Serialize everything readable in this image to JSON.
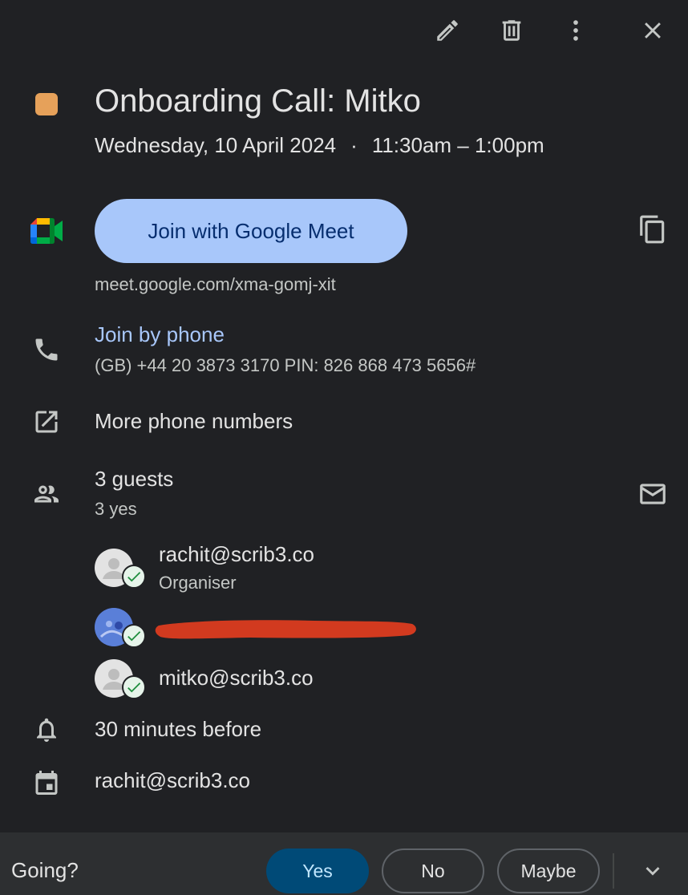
{
  "toolbar": {
    "icons": [
      "edit-icon",
      "delete-icon",
      "more-vert-icon",
      "close-icon"
    ]
  },
  "event": {
    "title": "Onboarding Call: Mitko",
    "date": "Wednesday, 10 April 2024",
    "separator": "·",
    "time": "11:30am – 1:00pm",
    "color": "#e6a15a"
  },
  "meet": {
    "button_label": "Join with Google Meet",
    "url": "meet.google.com/xma-gomj-xit",
    "button_color": "#a8c7fa"
  },
  "phone": {
    "link_label": "Join by phone",
    "detail": "(GB) +44 20 3873 3170 PIN: 826 868 473 5656#"
  },
  "more_numbers": {
    "label": "More phone numbers"
  },
  "guests": {
    "count_label": "3 guests",
    "summary": "3 yes",
    "list": [
      {
        "email": "rachit@scrib3.co",
        "role": "Organiser"
      },
      {
        "email": "",
        "role": ""
      },
      {
        "email": "mitko@scrib3.co",
        "role": ""
      }
    ]
  },
  "reminder": {
    "label": "30 minutes before"
  },
  "calendar": {
    "owner": "rachit@scrib3.co"
  },
  "rsvp": {
    "prompt": "Going?",
    "yes": "Yes",
    "no": "No",
    "maybe": "Maybe",
    "selected": "Yes"
  }
}
